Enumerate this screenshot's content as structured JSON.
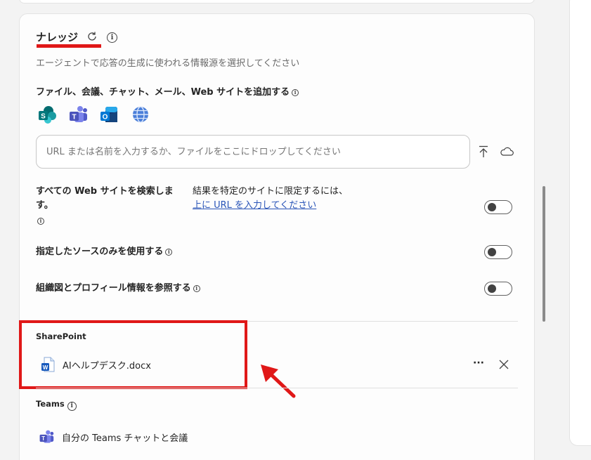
{
  "knowledge": {
    "title": "ナレッジ",
    "description": "エージェントで応答の生成に使われる情報源を選択してください",
    "add_label": "ファイル、会議、チャット、メール、Web サイトを追加する",
    "source_icons": [
      "sharepoint-icon",
      "teams-icon",
      "outlook-icon",
      "web-globe-icon"
    ],
    "url_placeholder": "URL または名前を入力するか、ファイルをここにドロップしてください"
  },
  "settings": {
    "web_search_label_1": "すべての Web サイトを検索しま",
    "web_search_label_2": "す。",
    "web_search_note": "結果を特定のサイトに限定するには、",
    "web_search_link": "上に URL を入力してください",
    "web_search_on": false,
    "only_sources_label": "指定したソースのみを使用する",
    "only_sources_on": false,
    "org_chart_label": "組織図とプロフィール情報を参照する",
    "org_chart_on": false
  },
  "sharepoint": {
    "heading": "SharePoint",
    "file_name": "AIヘルプデスク.docx",
    "more_label": "···"
  },
  "teams": {
    "heading": "Teams",
    "item_label": "自分の Teams チャットと会議"
  },
  "colors": {
    "highlight": "#e01818",
    "link": "#2a55b8"
  }
}
